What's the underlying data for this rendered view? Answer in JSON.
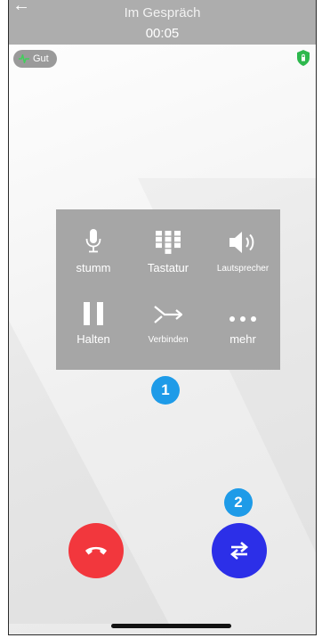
{
  "header": {
    "title": "Im Gespräch",
    "timer": "00:05"
  },
  "quality": {
    "label": "Gut",
    "icon": "pulse-icon"
  },
  "security": {
    "icon": "shield-icon",
    "color": "#2db84d"
  },
  "controls": [
    {
      "id": "mute",
      "label": "stumm",
      "icon": "microphone-icon"
    },
    {
      "id": "keypad",
      "label": "Tastatur",
      "icon": "keypad-icon"
    },
    {
      "id": "speaker",
      "label": "Lautsprecher",
      "icon": "speaker-icon"
    },
    {
      "id": "hold",
      "label": "Halten",
      "icon": "pause-icon"
    },
    {
      "id": "connect",
      "label": "Verbinden",
      "icon": "merge-icon"
    },
    {
      "id": "more",
      "label": "mehr",
      "icon": "more-icon"
    }
  ],
  "annotations": [
    {
      "label": "1"
    },
    {
      "label": "2"
    }
  ],
  "actions": {
    "hangup": {
      "icon": "hangup-icon",
      "color": "#f2373d"
    },
    "transfer": {
      "icon": "transfer-icon",
      "color": "#2c2fe8"
    }
  },
  "colors": {
    "header": "#adadad",
    "panel": "#a6a6a6",
    "annotation": "#1e9be8"
  }
}
